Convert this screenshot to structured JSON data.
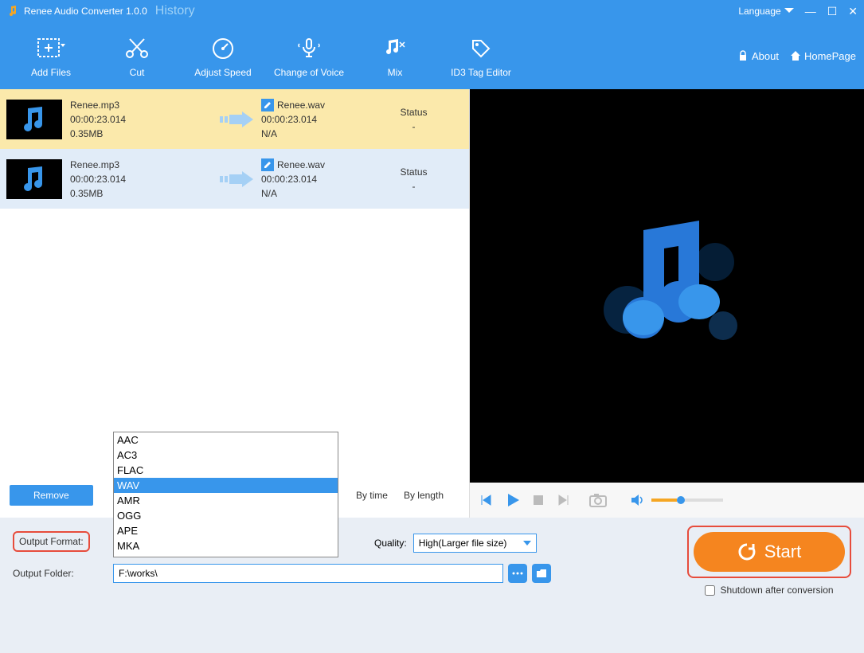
{
  "titlebar": {
    "app_title": "Renee Audio Converter 1.0.0",
    "history": "History",
    "language": "Language"
  },
  "toolbar": {
    "add_files": "Add Files",
    "cut": "Cut",
    "adjust_speed": "Adjust Speed",
    "change_voice": "Change of Voice",
    "mix": "Mix",
    "id3": "ID3 Tag Editor",
    "about": "About",
    "homepage": "HomePage"
  },
  "files": [
    {
      "name": "Renee.mp3",
      "duration": "00:00:23.014",
      "size": "0.35MB",
      "outname": "Renee.wav",
      "outduration": "00:00:23.014",
      "outsize": "N/A",
      "status_label": "Status",
      "status_value": "-"
    },
    {
      "name": "Renee.mp3",
      "duration": "00:00:23.014",
      "size": "0.35MB",
      "outname": "Renee.wav",
      "outduration": "00:00:23.014",
      "outsize": "N/A",
      "status_label": "Status",
      "status_value": "-"
    }
  ],
  "bottombar": {
    "remove": "Remove",
    "by_time": "By time",
    "by_length": "By length"
  },
  "settings": {
    "output_format_label": "Output Format:",
    "output_format_value": "WAV",
    "output_folder_label": "Output Folder:",
    "output_folder_value": "F:\\works\\",
    "quality_label": "Quality:",
    "quality_value": "High(Larger file size)",
    "start": "Start",
    "shutdown": "Shutdown after conversion"
  },
  "format_options": [
    "AAC",
    "AC3",
    "FLAC",
    "WAV",
    "AMR",
    "OGG",
    "APE",
    "MKA"
  ],
  "format_selected": "WAV"
}
